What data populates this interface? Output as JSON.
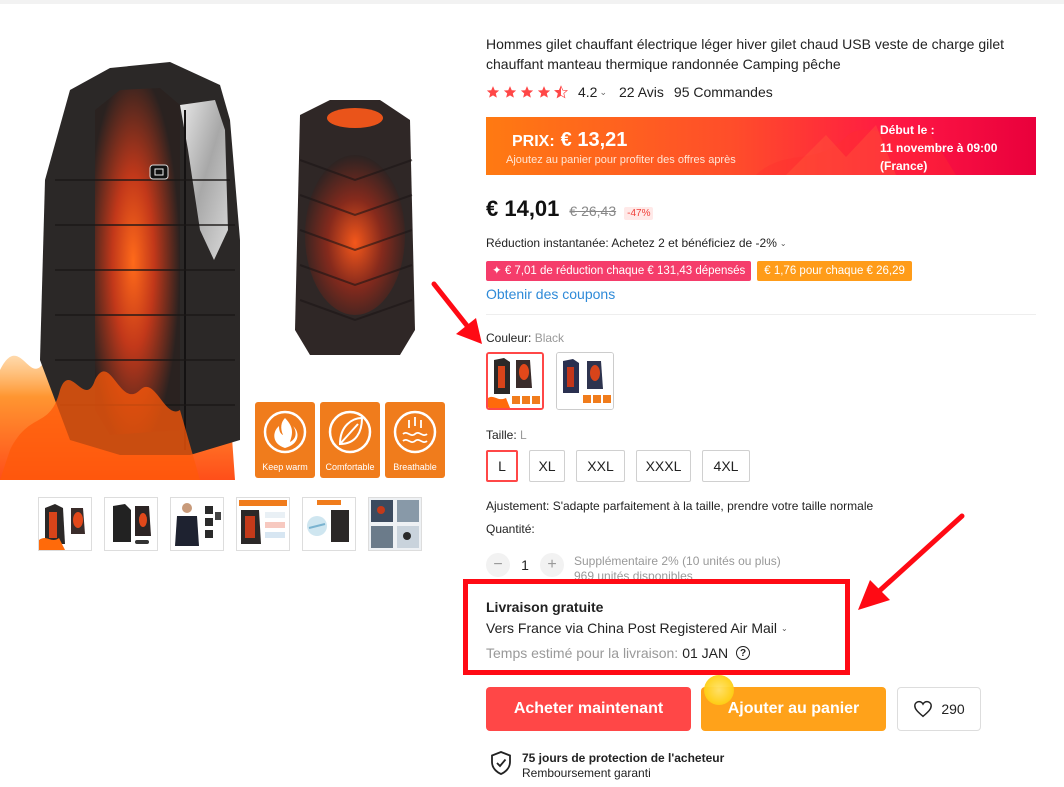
{
  "product": {
    "title": "Hommes gilet chauffant électrique léger hiver gilet chaud USB veste de charge gilet chauffant manteau thermique randonnée Camping pêche"
  },
  "rating": {
    "score": "4.2",
    "stars_filled": 4.2,
    "reviews": "22 Avis",
    "orders": "95 Commandes"
  },
  "promo": {
    "prix_label": "PRIX:",
    "prix_value": "€ 13,21",
    "subtitle": "Ajoutez au panier pour profiter des offres après",
    "start_line1": "Début le :",
    "start_line2": "11 novembre à 09:00",
    "start_line3": "(France)"
  },
  "price": {
    "current": "€ 14,01",
    "original": "€ 26,43",
    "discount": "-47%"
  },
  "instant_reduction": "Réduction instantanée: Achetez 2 et bénéficiez de -2%",
  "coupons": {
    "red": "✦ € 7,01 de réduction chaque € 131,43 dépensés",
    "orange": "€ 1,76 pour chaque € 26,29",
    "link": "Obtenir des coupons"
  },
  "color": {
    "label": "Couleur: ",
    "value": "Black"
  },
  "size": {
    "label": "Taille: ",
    "value": "L",
    "options": [
      "L",
      "XL",
      "XXL",
      "XXXL",
      "4XL"
    ]
  },
  "fit": "Ajustement: S'adapte parfaitement à la taille, prendre votre taille normale",
  "quantity": {
    "label": "Quantité:",
    "value": "1",
    "minus": "−",
    "plus": "+",
    "extra": "Supplémentaire 2% (10 unités ou plus)",
    "available": "969 unités disponibles"
  },
  "shipping": {
    "title": "Livraison gratuite",
    "via": "Vers France via China Post Registered Air Mail",
    "time_label": "Temps estimé pour la livraison:",
    "time_value": "01 JAN",
    "help": "?"
  },
  "buttons": {
    "buy": "Acheter maintenant",
    "cart": "Ajouter au panier",
    "wish_count": "290"
  },
  "protection": {
    "title": "75 jours de protection de l'acheteur",
    "subtitle": "Remboursement garanti"
  },
  "features": {
    "keep_warm": "Keep warm",
    "comfortable": "Comfortable",
    "breathable": "Breathable"
  },
  "colors": {
    "primary_red": "#ff4747",
    "cart_orange": "#ffa21a",
    "link_blue": "#2e8ad8",
    "annotation_red": "#ff0a14"
  },
  "icons": [
    "shield-check-icon",
    "heart-icon",
    "star-icon",
    "help-icon",
    "chevron-down-icon",
    "fire-icon",
    "leaf-icon",
    "breathable-icon"
  ]
}
